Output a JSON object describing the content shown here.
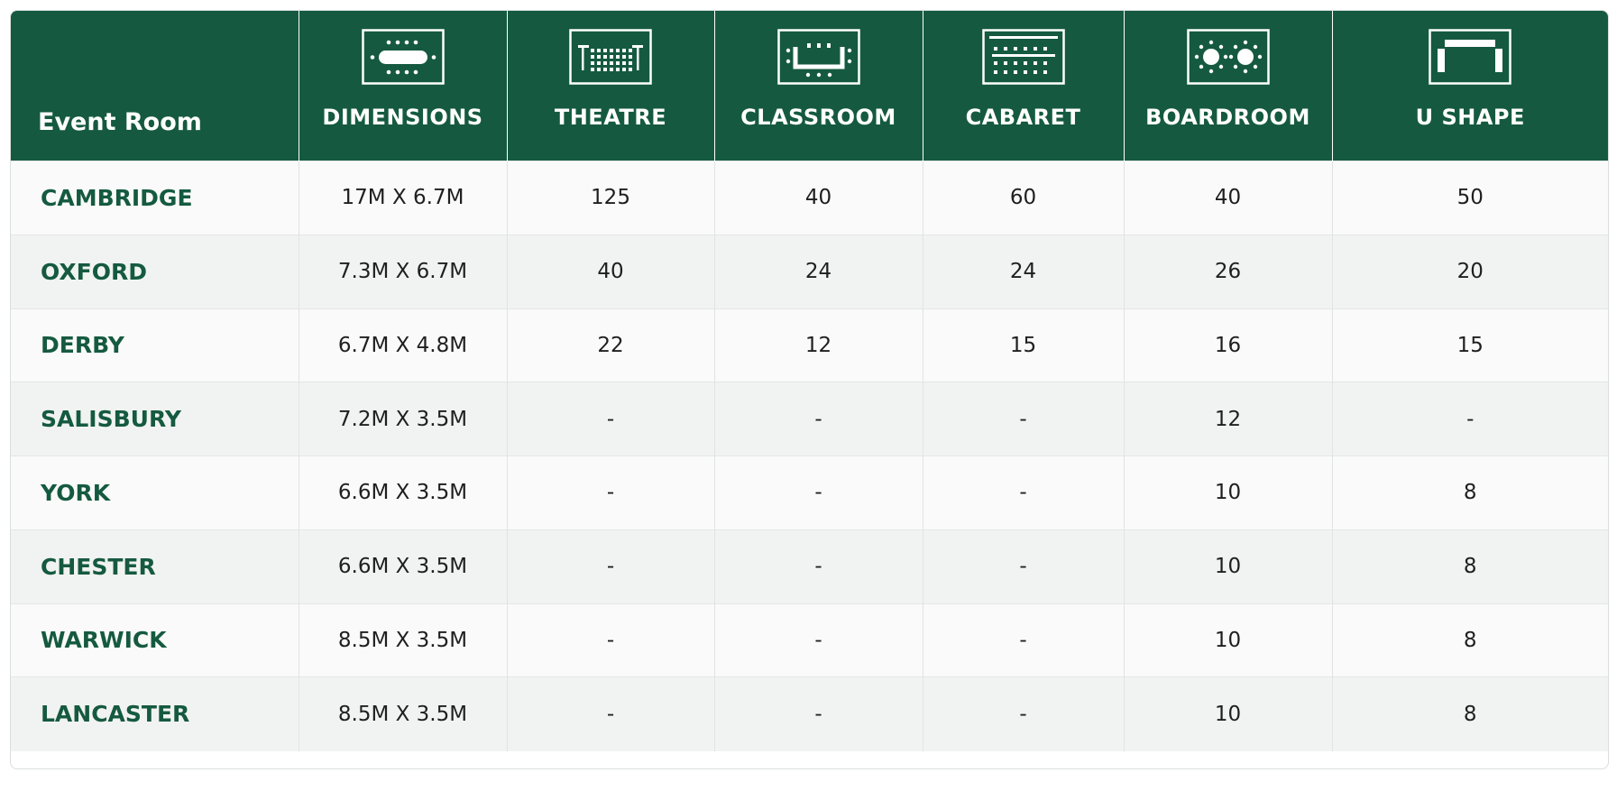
{
  "header": {
    "first_column": "Event Room",
    "columns": [
      {
        "label": "DIMENSIONS",
        "icon": "boardroom-table-icon"
      },
      {
        "label": "THEATRE",
        "icon": "theatre-layout-icon"
      },
      {
        "label": "CLASSROOM",
        "icon": "classroom-layout-icon"
      },
      {
        "label": "CABARET",
        "icon": "cabaret-layout-icon"
      },
      {
        "label": "BOARDROOM",
        "icon": "round-tables-layout-icon"
      },
      {
        "label": "U SHAPE",
        "icon": "u-shape-layout-icon"
      }
    ]
  },
  "rows": [
    {
      "room": "CAMBRIDGE",
      "cells": [
        "17M X 6.7M",
        "125",
        "40",
        "60",
        "40",
        "50"
      ]
    },
    {
      "room": "OXFORD",
      "cells": [
        "7.3M X 6.7M",
        "40",
        "24",
        "24",
        "26",
        "20"
      ]
    },
    {
      "room": "DERBY",
      "cells": [
        "6.7M X 4.8M",
        "22",
        "12",
        "15",
        "16",
        "15"
      ]
    },
    {
      "room": "SALISBURY",
      "cells": [
        "7.2M X 3.5M",
        "-",
        "-",
        "-",
        "12",
        "-"
      ]
    },
    {
      "room": "YORK",
      "cells": [
        "6.6M X 3.5M",
        "-",
        "-",
        "-",
        "10",
        "8"
      ]
    },
    {
      "room": "CHESTER",
      "cells": [
        "6.6M X 3.5M",
        "-",
        "-",
        "-",
        "10",
        "8"
      ]
    },
    {
      "room": "WARWICK",
      "cells": [
        "8.5M X 3.5M",
        "-",
        "-",
        "-",
        "10",
        "8"
      ]
    },
    {
      "room": "LANCASTER",
      "cells": [
        "8.5M X 3.5M",
        "-",
        "-",
        "-",
        "10",
        "8"
      ]
    }
  ],
  "colors": {
    "header_bg": "#155a40",
    "room_text": "#155a40"
  }
}
